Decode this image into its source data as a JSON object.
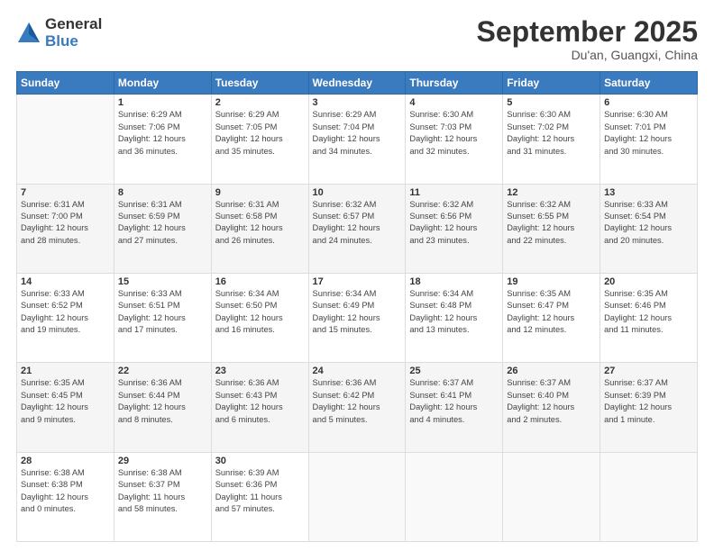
{
  "logo": {
    "general": "General",
    "blue": "Blue"
  },
  "header": {
    "month": "September 2025",
    "location": "Du'an, Guangxi, China"
  },
  "weekdays": [
    "Sunday",
    "Monday",
    "Tuesday",
    "Wednesday",
    "Thursday",
    "Friday",
    "Saturday"
  ],
  "weeks": [
    [
      {
        "day": "",
        "info": ""
      },
      {
        "day": "1",
        "info": "Sunrise: 6:29 AM\nSunset: 7:06 PM\nDaylight: 12 hours\nand 36 minutes."
      },
      {
        "day": "2",
        "info": "Sunrise: 6:29 AM\nSunset: 7:05 PM\nDaylight: 12 hours\nand 35 minutes."
      },
      {
        "day": "3",
        "info": "Sunrise: 6:29 AM\nSunset: 7:04 PM\nDaylight: 12 hours\nand 34 minutes."
      },
      {
        "day": "4",
        "info": "Sunrise: 6:30 AM\nSunset: 7:03 PM\nDaylight: 12 hours\nand 32 minutes."
      },
      {
        "day": "5",
        "info": "Sunrise: 6:30 AM\nSunset: 7:02 PM\nDaylight: 12 hours\nand 31 minutes."
      },
      {
        "day": "6",
        "info": "Sunrise: 6:30 AM\nSunset: 7:01 PM\nDaylight: 12 hours\nand 30 minutes."
      }
    ],
    [
      {
        "day": "7",
        "info": "Sunrise: 6:31 AM\nSunset: 7:00 PM\nDaylight: 12 hours\nand 28 minutes."
      },
      {
        "day": "8",
        "info": "Sunrise: 6:31 AM\nSunset: 6:59 PM\nDaylight: 12 hours\nand 27 minutes."
      },
      {
        "day": "9",
        "info": "Sunrise: 6:31 AM\nSunset: 6:58 PM\nDaylight: 12 hours\nand 26 minutes."
      },
      {
        "day": "10",
        "info": "Sunrise: 6:32 AM\nSunset: 6:57 PM\nDaylight: 12 hours\nand 24 minutes."
      },
      {
        "day": "11",
        "info": "Sunrise: 6:32 AM\nSunset: 6:56 PM\nDaylight: 12 hours\nand 23 minutes."
      },
      {
        "day": "12",
        "info": "Sunrise: 6:32 AM\nSunset: 6:55 PM\nDaylight: 12 hours\nand 22 minutes."
      },
      {
        "day": "13",
        "info": "Sunrise: 6:33 AM\nSunset: 6:54 PM\nDaylight: 12 hours\nand 20 minutes."
      }
    ],
    [
      {
        "day": "14",
        "info": "Sunrise: 6:33 AM\nSunset: 6:52 PM\nDaylight: 12 hours\nand 19 minutes."
      },
      {
        "day": "15",
        "info": "Sunrise: 6:33 AM\nSunset: 6:51 PM\nDaylight: 12 hours\nand 17 minutes."
      },
      {
        "day": "16",
        "info": "Sunrise: 6:34 AM\nSunset: 6:50 PM\nDaylight: 12 hours\nand 16 minutes."
      },
      {
        "day": "17",
        "info": "Sunrise: 6:34 AM\nSunset: 6:49 PM\nDaylight: 12 hours\nand 15 minutes."
      },
      {
        "day": "18",
        "info": "Sunrise: 6:34 AM\nSunset: 6:48 PM\nDaylight: 12 hours\nand 13 minutes."
      },
      {
        "day": "19",
        "info": "Sunrise: 6:35 AM\nSunset: 6:47 PM\nDaylight: 12 hours\nand 12 minutes."
      },
      {
        "day": "20",
        "info": "Sunrise: 6:35 AM\nSunset: 6:46 PM\nDaylight: 12 hours\nand 11 minutes."
      }
    ],
    [
      {
        "day": "21",
        "info": "Sunrise: 6:35 AM\nSunset: 6:45 PM\nDaylight: 12 hours\nand 9 minutes."
      },
      {
        "day": "22",
        "info": "Sunrise: 6:36 AM\nSunset: 6:44 PM\nDaylight: 12 hours\nand 8 minutes."
      },
      {
        "day": "23",
        "info": "Sunrise: 6:36 AM\nSunset: 6:43 PM\nDaylight: 12 hours\nand 6 minutes."
      },
      {
        "day": "24",
        "info": "Sunrise: 6:36 AM\nSunset: 6:42 PM\nDaylight: 12 hours\nand 5 minutes."
      },
      {
        "day": "25",
        "info": "Sunrise: 6:37 AM\nSunset: 6:41 PM\nDaylight: 12 hours\nand 4 minutes."
      },
      {
        "day": "26",
        "info": "Sunrise: 6:37 AM\nSunset: 6:40 PM\nDaylight: 12 hours\nand 2 minutes."
      },
      {
        "day": "27",
        "info": "Sunrise: 6:37 AM\nSunset: 6:39 PM\nDaylight: 12 hours\nand 1 minute."
      }
    ],
    [
      {
        "day": "28",
        "info": "Sunrise: 6:38 AM\nSunset: 6:38 PM\nDaylight: 12 hours\nand 0 minutes."
      },
      {
        "day": "29",
        "info": "Sunrise: 6:38 AM\nSunset: 6:37 PM\nDaylight: 11 hours\nand 58 minutes."
      },
      {
        "day": "30",
        "info": "Sunrise: 6:39 AM\nSunset: 6:36 PM\nDaylight: 11 hours\nand 57 minutes."
      },
      {
        "day": "",
        "info": ""
      },
      {
        "day": "",
        "info": ""
      },
      {
        "day": "",
        "info": ""
      },
      {
        "day": "",
        "info": ""
      }
    ]
  ]
}
